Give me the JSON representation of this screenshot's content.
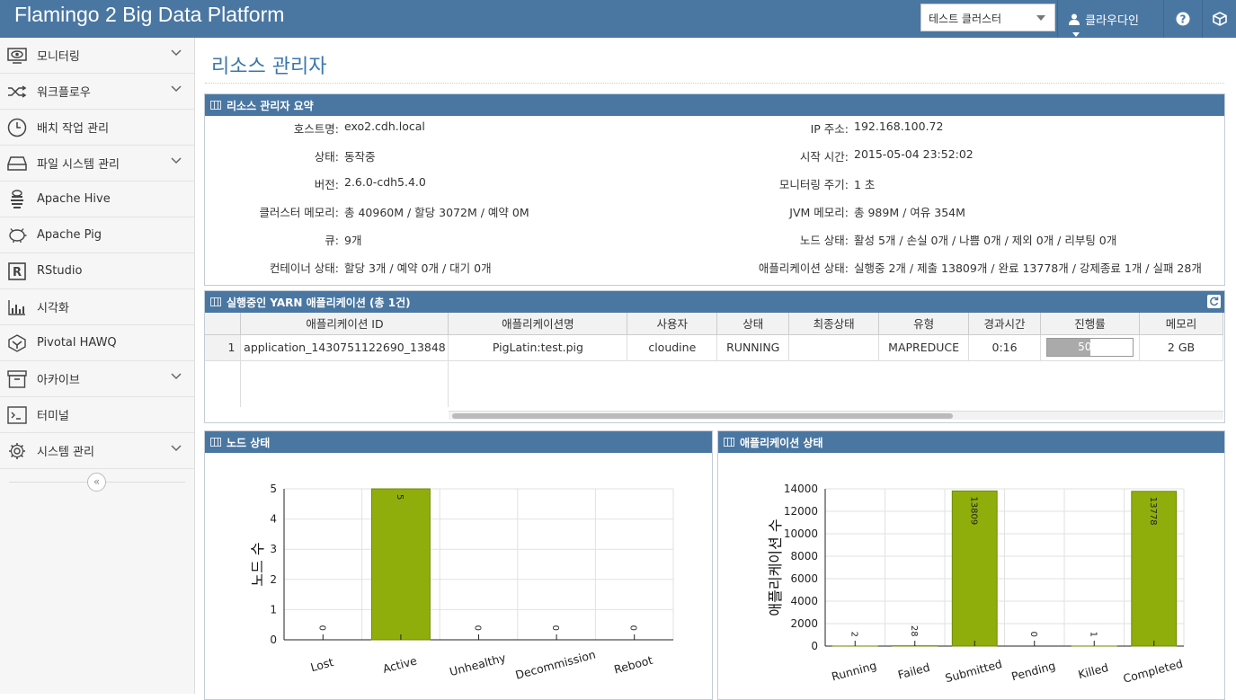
{
  "app": {
    "title": "Flamingo 2 Big Data Platform",
    "cluster_select": "테스트 클러스터",
    "user": "클라우다인"
  },
  "sidebar": {
    "items": [
      {
        "label": "모니터링",
        "icon": "eye-icon",
        "expandable": true
      },
      {
        "label": "워크플로우",
        "icon": "shuffle-icon",
        "expandable": true
      },
      {
        "label": "배치 작업 관리",
        "icon": "clock-icon",
        "expandable": false
      },
      {
        "label": "파일 시스템 관리",
        "icon": "hard-drive-icon",
        "expandable": true
      },
      {
        "label": "Apache Hive",
        "icon": "hive-icon",
        "expandable": false
      },
      {
        "label": "Apache Pig",
        "icon": "pig-icon",
        "expandable": false
      },
      {
        "label": "RStudio",
        "icon": "rstudio-icon",
        "expandable": false
      },
      {
        "label": "시각화",
        "icon": "bar-chart-icon",
        "expandable": false
      },
      {
        "label": "Pivotal HAWQ",
        "icon": "hawq-icon",
        "expandable": false
      },
      {
        "label": "아카이브",
        "icon": "archive-icon",
        "expandable": true
      },
      {
        "label": "터미널",
        "icon": "terminal-icon",
        "expandable": false
      },
      {
        "label": "시스템 관리",
        "icon": "gear-icon",
        "expandable": true
      }
    ],
    "collapse_glyph": "«"
  },
  "page": {
    "title": "리소스 관리자"
  },
  "summary": {
    "title": "리소스 관리자 요약",
    "left": [
      {
        "label": "호스트명:",
        "value": "exo2.cdh.local"
      },
      {
        "label": "상태:",
        "value": "동작중"
      },
      {
        "label": "버전:",
        "value": "2.6.0-cdh5.4.0"
      },
      {
        "label": "클러스터 메모리:",
        "value": "총 40960M / 할당 3072M / 예약 0M"
      },
      {
        "label": "큐:",
        "value": "9개"
      },
      {
        "label": "컨테이너 상태:",
        "value": "할당 3개 / 예약 0개 / 대기 0개"
      }
    ],
    "right": [
      {
        "label": "IP 주소:",
        "value": "192.168.100.72"
      },
      {
        "label": "시작 시간:",
        "value": "2015-05-04 23:52:02"
      },
      {
        "label": "모니터링 주기:",
        "value": "1 초"
      },
      {
        "label": "JVM 메모리:",
        "value": "총 989M / 여유 354M"
      },
      {
        "label": "노드 상태:",
        "value": "활성 5개 / 손실 0개 / 나쁨 0개 / 제외 0개 / 리부팅 0개"
      },
      {
        "label": "애플리케이션 상태:",
        "value": "실행중 2개 / 제출 13809개 / 완료 13778개 / 강제종료 1개 / 실패 28개"
      }
    ]
  },
  "apps_grid": {
    "title": "실행중인 YARN 애플리케이션 (총 1건)",
    "columns": [
      "애플리케이션 ID",
      "애플리케이션명",
      "사용자",
      "상태",
      "최종상태",
      "유형",
      "경과시간",
      "진행률",
      "메모리"
    ],
    "rows": [
      {
        "num": "1",
        "id": "application_1430751122690_13848",
        "name": "PigLatin:test.pig",
        "user": "cloudine",
        "state": "RUNNING",
        "final": "",
        "type": "MAPREDUCE",
        "elapsed": "0:16",
        "progress": 50,
        "progress_text": "50%",
        "memory": "2 GB"
      }
    ]
  },
  "node_panel": {
    "title": "노드 상태"
  },
  "app_panel": {
    "title": "애플리케이션 상태"
  },
  "colors": {
    "header": "#4a77a2",
    "bar": "#8fae0b",
    "title": "#3a77ad"
  },
  "chart_data": [
    {
      "type": "bar",
      "categories": [
        "Lost",
        "Active",
        "Unhealthy",
        "Decommission",
        "Reboot"
      ],
      "values": [
        0,
        5,
        0,
        0,
        0
      ],
      "ylabel": "노드 수",
      "ylim": [
        0,
        5
      ],
      "yticks": [
        0,
        1,
        2,
        3,
        4,
        5
      ],
      "grid": true
    },
    {
      "type": "bar",
      "categories": [
        "Running",
        "Failed",
        "Submitted",
        "Pending",
        "Killed",
        "Completed"
      ],
      "values": [
        2,
        28,
        13809,
        0,
        1,
        13778
      ],
      "ylabel": "애플리케이션 수",
      "ylim": [
        0,
        14000
      ],
      "yticks": [
        0,
        2000,
        4000,
        6000,
        8000,
        10000,
        12000,
        14000
      ],
      "grid": true
    }
  ]
}
